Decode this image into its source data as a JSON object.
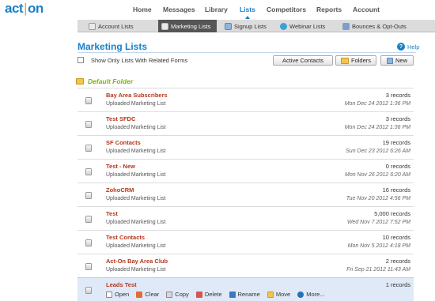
{
  "brand": {
    "logo_left": "act",
    "logo_sep": "|",
    "logo_right": "on"
  },
  "nav": [
    "Home",
    "Messages",
    "Library",
    "Lists",
    "Competitors",
    "Reports",
    "Account"
  ],
  "subnav": [
    "Account Lists",
    "Marketing Lists",
    "Signup Lists",
    "Webinar Lists",
    "Bounces & Opt-Outs"
  ],
  "page": {
    "title": "Marketing Lists",
    "help": "Help",
    "help_icon": "?"
  },
  "toolbar": {
    "checkbox_label": "Show Only Lists With Related Forms",
    "active_contacts": "Active Contacts",
    "folders": "Folders",
    "new": "New"
  },
  "folder": {
    "label": "Default Folder"
  },
  "rows": [
    {
      "name": "Bay Area Subscribers",
      "type": "Uploaded Marketing List",
      "count": "3 records",
      "date": "Mon Dec 24 2012 1:36 PM"
    },
    {
      "name": "Test SFDC",
      "type": "Uploaded Marketing List",
      "count": "3 records",
      "date": "Mon Dec 24 2012 1:36 PM"
    },
    {
      "name": "SF Contacts",
      "type": "Uploaded Marketing List",
      "count": "19 records",
      "date": "Sun Dec 23 2012 6:26 AM"
    },
    {
      "name": "Test - New",
      "type": "Uploaded Marketing List",
      "count": "0 records",
      "date": "Mon Nov 26 2012 6:20 AM"
    },
    {
      "name": "ZohoCRM",
      "type": "Uploaded Marketing List",
      "count": "16 records",
      "date": "Tue Nov 20 2012 4:56 PM"
    },
    {
      "name": "Test",
      "type": "Uploaded Marketing List",
      "count": "5,000 records",
      "date": "Wed Nov 7 2012 7:52 PM"
    },
    {
      "name": "Test Contacts",
      "type": "Uploaded Marketing List",
      "count": "10 records",
      "date": "Mon Nov 5 2012 4:18 PM"
    },
    {
      "name": "Act-On Bay Area Club",
      "type": "Uploaded Marketing List",
      "count": "2 records",
      "date": "Fri Sep 21 2012 11:43 AM"
    }
  ],
  "selected_row": {
    "name": "Leads Test",
    "count": "1 records"
  },
  "row_actions": [
    "Open",
    "Clear",
    "Copy",
    "Delete",
    "Rename",
    "Move",
    "More..."
  ],
  "colors": {
    "accent": "#1a7fc7",
    "list_name": "#b5361c",
    "folder_label": "#7ab800",
    "selected_bg": "#dfe9f7"
  }
}
